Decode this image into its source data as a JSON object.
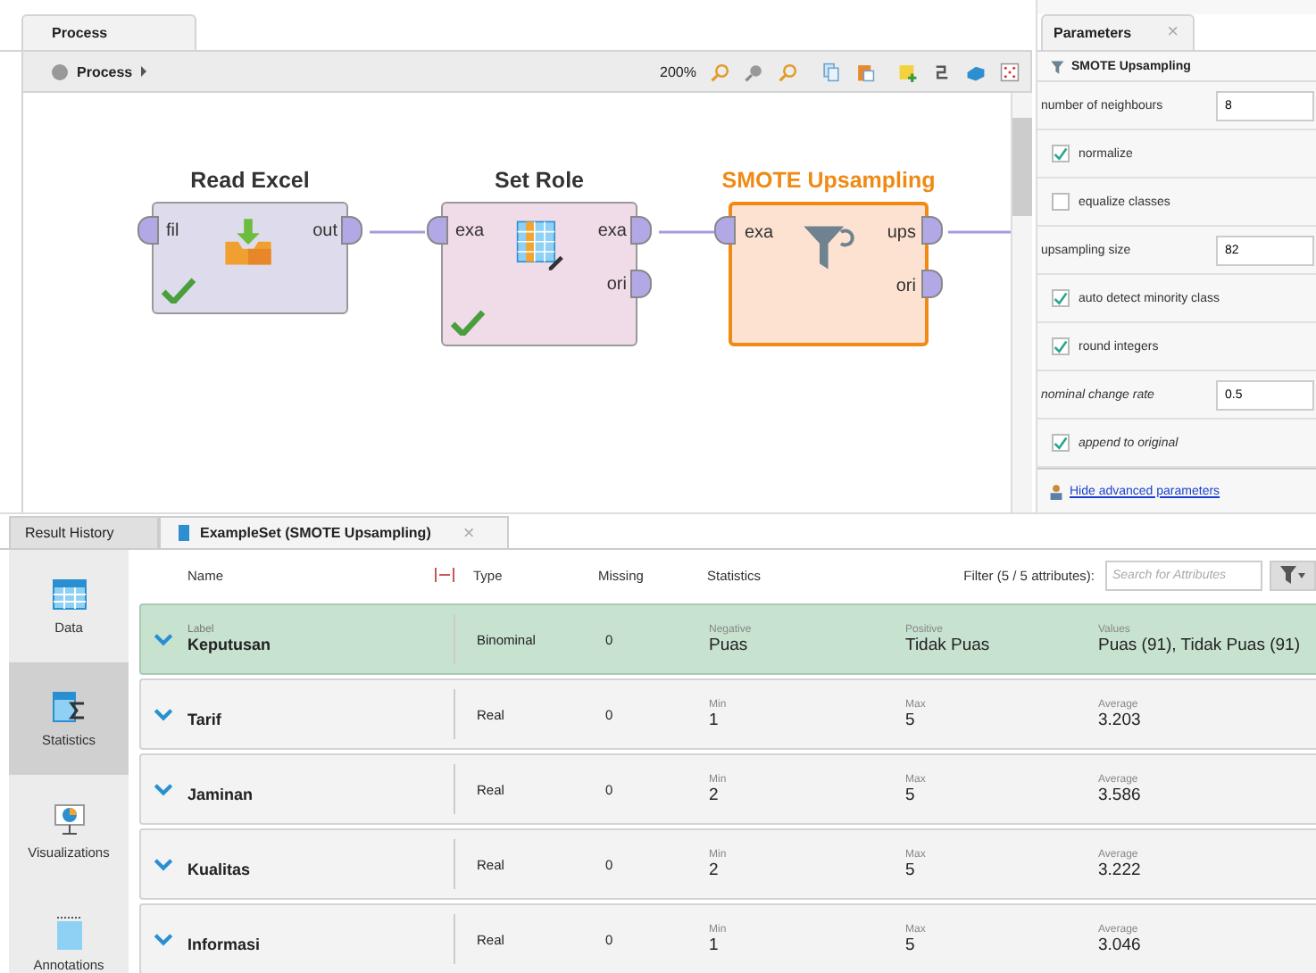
{
  "process_panel": {
    "tab": "Process",
    "breadcrumb": "Process",
    "zoom": "200%"
  },
  "operators": [
    {
      "name": "Read Excel",
      "kind": "read",
      "selected": false,
      "ok": true,
      "inputs": [
        "fil"
      ],
      "outputs": [
        "out"
      ]
    },
    {
      "name": "Set Role",
      "kind": "role",
      "selected": false,
      "ok": true,
      "inputs": [
        "exa"
      ],
      "outputs": [
        "exa",
        "ori"
      ]
    },
    {
      "name": "SMOTE Upsampling",
      "kind": "filter",
      "selected": true,
      "ok": false,
      "inputs": [
        "exa"
      ],
      "outputs": [
        "ups",
        "ori"
      ]
    }
  ],
  "parameters": {
    "tab": "Parameters",
    "close": "×",
    "operator": "SMOTE Upsampling",
    "link": "Hide advanced parameters",
    "items": [
      {
        "kind": "field",
        "label": "number of neighbours",
        "value": "8",
        "expert": false
      },
      {
        "kind": "checkbox",
        "label": "normalize",
        "checked": true,
        "expert": false
      },
      {
        "kind": "checkbox",
        "label": "equalize classes",
        "checked": false,
        "expert": false
      },
      {
        "kind": "field",
        "label": "upsampling size",
        "value": "82",
        "expert": false
      },
      {
        "kind": "checkbox",
        "label": "auto detect minority class",
        "checked": true,
        "expert": false
      },
      {
        "kind": "checkbox",
        "label": "round integers",
        "checked": true,
        "expert": false
      },
      {
        "kind": "field",
        "label": "nominal change rate",
        "value": "0.5",
        "expert": true
      },
      {
        "kind": "checkbox",
        "label": "append to original",
        "checked": true,
        "expert": true
      }
    ]
  },
  "results": {
    "tabs": [
      {
        "label": "Result History",
        "selected": false
      },
      {
        "label": "ExampleSet (SMOTE Upsampling)",
        "selected": true,
        "close": "×"
      }
    ],
    "views": [
      {
        "label": "Data",
        "kind": "data",
        "selected": false
      },
      {
        "label": "Statistics",
        "kind": "stats",
        "selected": true
      },
      {
        "label": "Visualizations",
        "kind": "vis",
        "selected": false
      },
      {
        "label": "Annotations",
        "kind": "notes",
        "selected": false
      }
    ],
    "columns": [
      "Name",
      "Type",
      "Missing",
      "Statistics"
    ],
    "filter_label": "Filter (5 / 5 attributes):",
    "search_placeholder": "Search for Attributes",
    "rows": [
      {
        "role": "Label",
        "name": "Keputusan",
        "type": "Binominal",
        "missing": "0",
        "stats": [
          {
            "label": "Negative",
            "value": "Puas"
          },
          {
            "label": "Positive",
            "value": "Tidak Puas"
          },
          {
            "label": "Values",
            "value": "Puas (91), Tidak Puas (91)"
          }
        ]
      },
      {
        "name": "Tarif",
        "type": "Real",
        "missing": "0",
        "stats": [
          {
            "label": "Min",
            "value": "1"
          },
          {
            "label": "Max",
            "value": "5"
          },
          {
            "label": "Average",
            "value": "3.203"
          }
        ]
      },
      {
        "name": "Jaminan",
        "type": "Real",
        "missing": "0",
        "stats": [
          {
            "label": "Min",
            "value": "2"
          },
          {
            "label": "Max",
            "value": "5"
          },
          {
            "label": "Average",
            "value": "3.586"
          }
        ]
      },
      {
        "name": "Kualitas",
        "type": "Real",
        "missing": "0",
        "stats": [
          {
            "label": "Min",
            "value": "2"
          },
          {
            "label": "Max",
            "value": "5"
          },
          {
            "label": "Average",
            "value": "3.222"
          }
        ]
      },
      {
        "name": "Informasi",
        "type": "Real",
        "missing": "0",
        "stats": [
          {
            "label": "Min",
            "value": "1"
          },
          {
            "label": "Max",
            "value": "5"
          },
          {
            "label": "Average",
            "value": "3.046"
          }
        ]
      }
    ]
  }
}
